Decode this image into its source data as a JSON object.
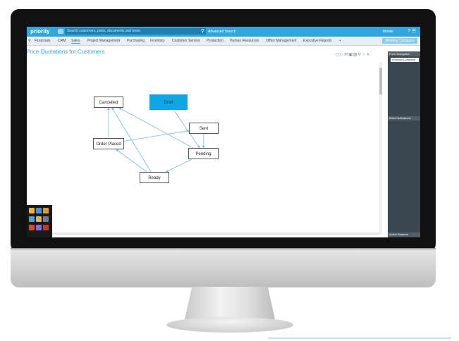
{
  "app": {
    "logo": "priority",
    "search_placeholder": "Search customers, parts, documents and more",
    "advanced_search": "Advanced Search",
    "user": "Mobile"
  },
  "nav": {
    "items": [
      "Financials",
      "CRM",
      "Sales",
      "Project Management",
      "Purchasing",
      "Inventory",
      "Customer Service",
      "Production",
      "Human Resources",
      "Office Management",
      "Executive Reports",
      "+"
    ],
    "active": "Sales",
    "working_company_button": "Working Company"
  },
  "page": {
    "title": "Price Quotations for Customers"
  },
  "right_panel": {
    "form_navigation": "Form Navigation",
    "working_company": "Working Company",
    "direct_activations": "Direct Activations",
    "active_screens": "Active Screens"
  },
  "flowchart": {
    "nodes": [
      {
        "id": "cancelled",
        "label": "Cancelled"
      },
      {
        "id": "draft",
        "label": "Draft"
      },
      {
        "id": "sent",
        "label": "Sent"
      },
      {
        "id": "order_placed",
        "label": "Order Placed"
      },
      {
        "id": "pending",
        "label": "Pending"
      },
      {
        "id": "ready",
        "label": "Ready"
      }
    ],
    "edges": [
      [
        "draft",
        "pending"
      ],
      [
        "order_placed",
        "cancelled"
      ],
      [
        "order_placed",
        "sent"
      ],
      [
        "pending",
        "cancelled"
      ],
      [
        "ready",
        "cancelled"
      ],
      [
        "ready",
        "order_placed"
      ],
      [
        "pending",
        "ready"
      ],
      [
        "sent",
        "pending"
      ]
    ],
    "accent_color": "#10a6e3",
    "edge_color": "#7db9e0"
  },
  "colors": {
    "topbar": "#2fa7dc",
    "panel": "#3a4650"
  }
}
